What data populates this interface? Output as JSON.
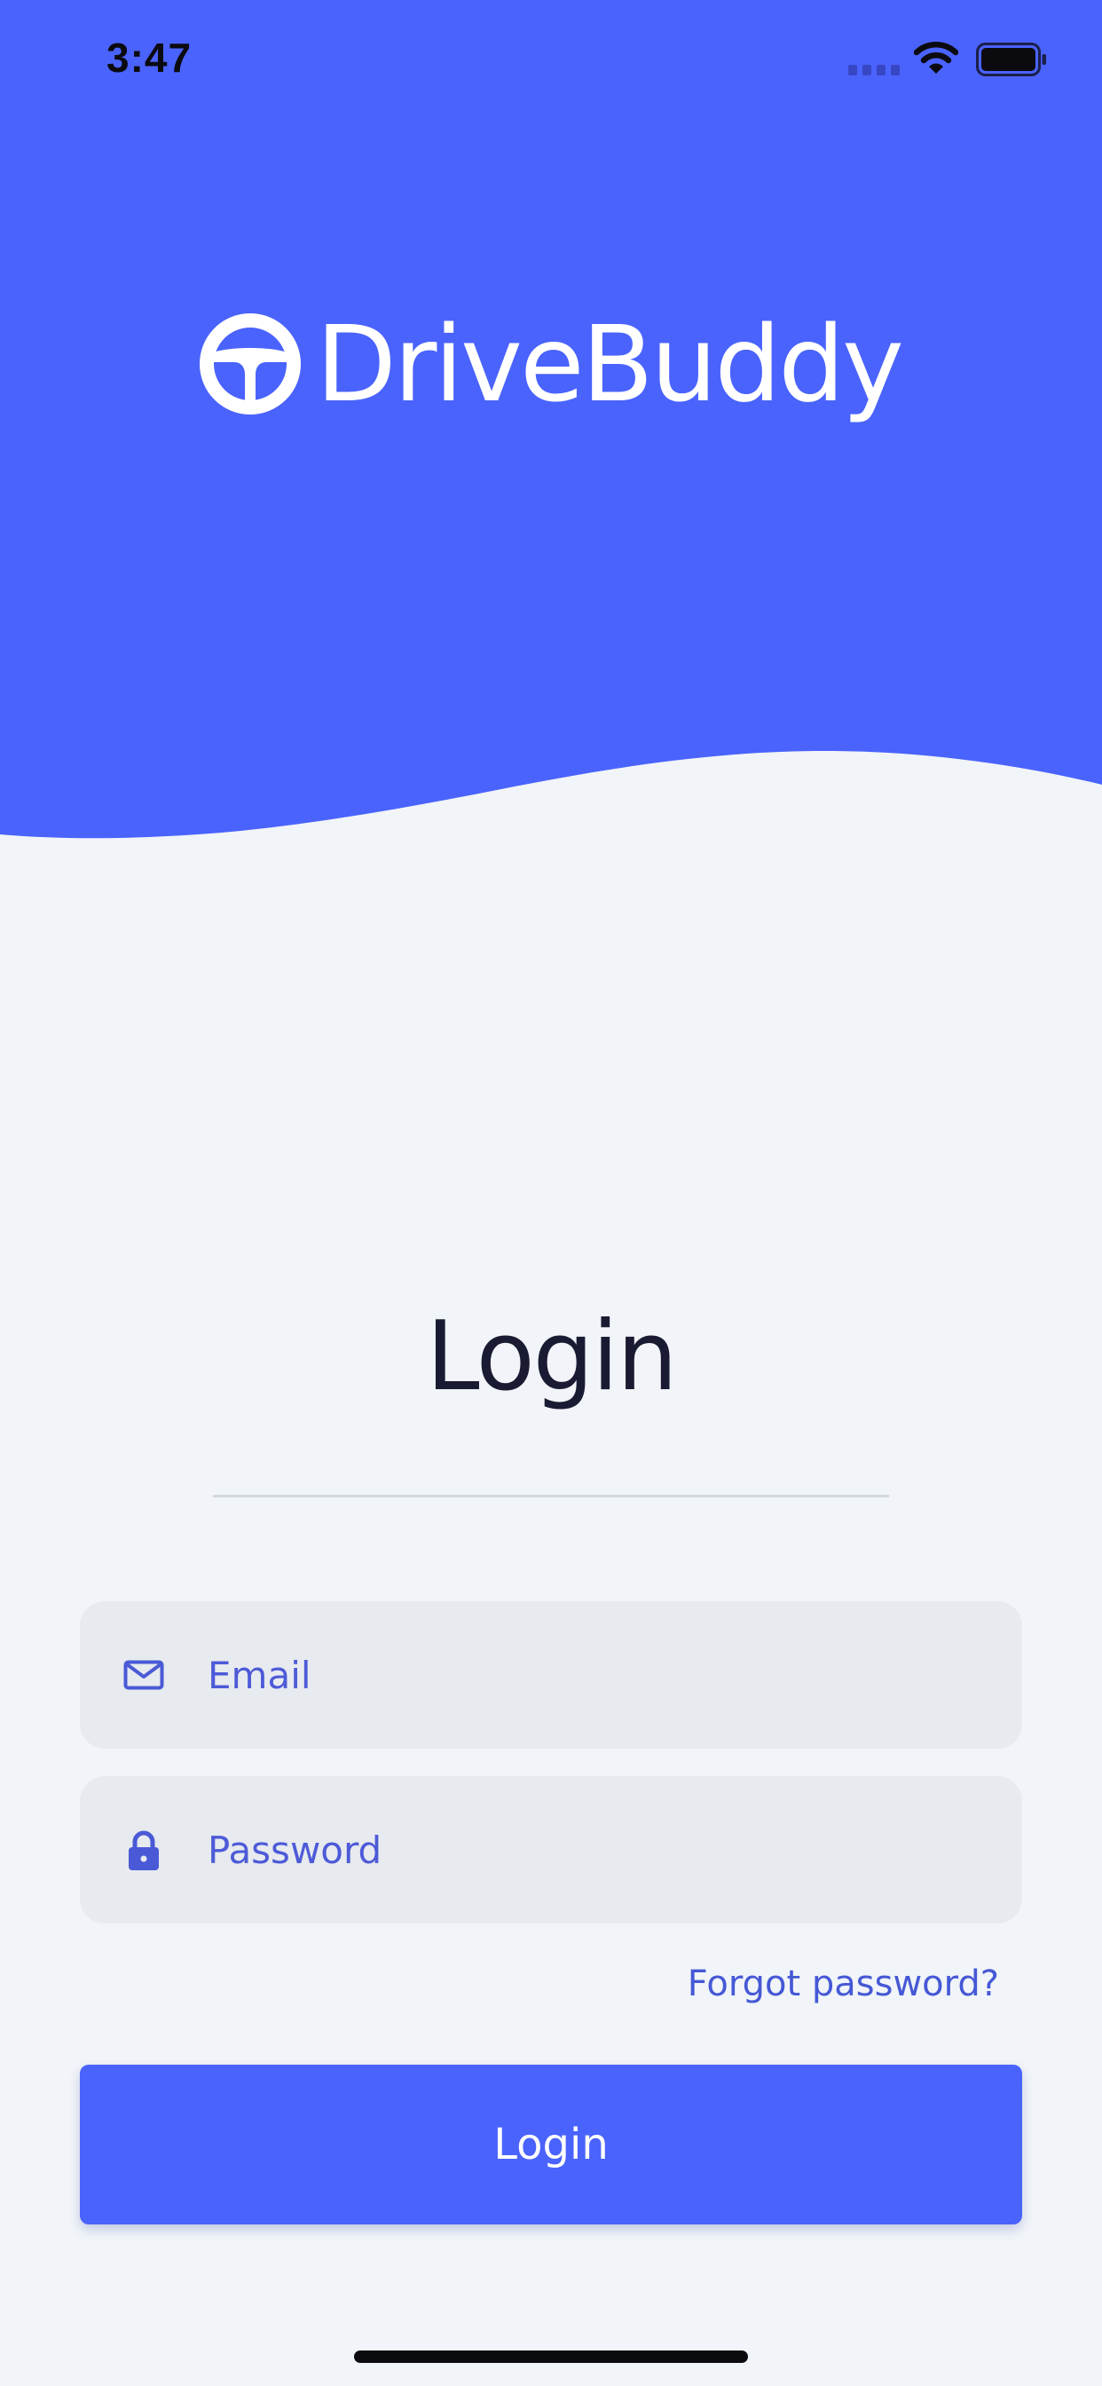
{
  "status_bar": {
    "time": "3:47"
  },
  "brand": {
    "name": "DriveBuddy",
    "logo_icon": "steering-wheel-icon"
  },
  "form": {
    "title": "Login",
    "email_placeholder": "Email",
    "password_placeholder": "Password",
    "forgot_password_label": "Forgot password?",
    "login_button_label": "Login"
  },
  "icons": {
    "email": "mail-icon",
    "password": "lock-icon"
  },
  "colors": {
    "primary": "#4a63fd",
    "background": "#f1f4f8",
    "field_background": "#e7eaee",
    "title_text": "#1a1b33",
    "accent_text": "#4558d6"
  }
}
